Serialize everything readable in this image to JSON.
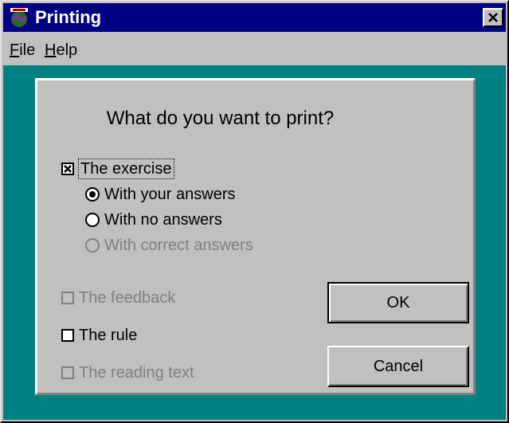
{
  "window": {
    "title": "Printing",
    "icon": "globe-app-icon",
    "close_glyph": "✕"
  },
  "menu": {
    "items": [
      {
        "label_mnemonic": "F",
        "label_rest": "ile"
      },
      {
        "label_mnemonic": "H",
        "label_rest": "elp"
      }
    ]
  },
  "dialog": {
    "heading": "What do you want to print?",
    "exercise": {
      "label": "The exercise",
      "checked": true,
      "enabled": true
    },
    "answer_options": [
      {
        "label": "With your answers",
        "selected": true,
        "enabled": true
      },
      {
        "label": "With no answers",
        "selected": false,
        "enabled": true
      },
      {
        "label": "With correct answers",
        "selected": false,
        "enabled": false
      }
    ],
    "feedback": {
      "label": "The feedback",
      "checked": false,
      "enabled": false
    },
    "rule": {
      "label": "The rule",
      "checked": false,
      "enabled": true
    },
    "reading_text": {
      "label": "The reading text",
      "checked": false,
      "enabled": false
    },
    "ok_label": "OK",
    "cancel_label": "Cancel"
  },
  "colors": {
    "titlebar": "#000080",
    "client_background": "#008080",
    "face": "#c0c0c0",
    "disabled_text": "#808080"
  }
}
